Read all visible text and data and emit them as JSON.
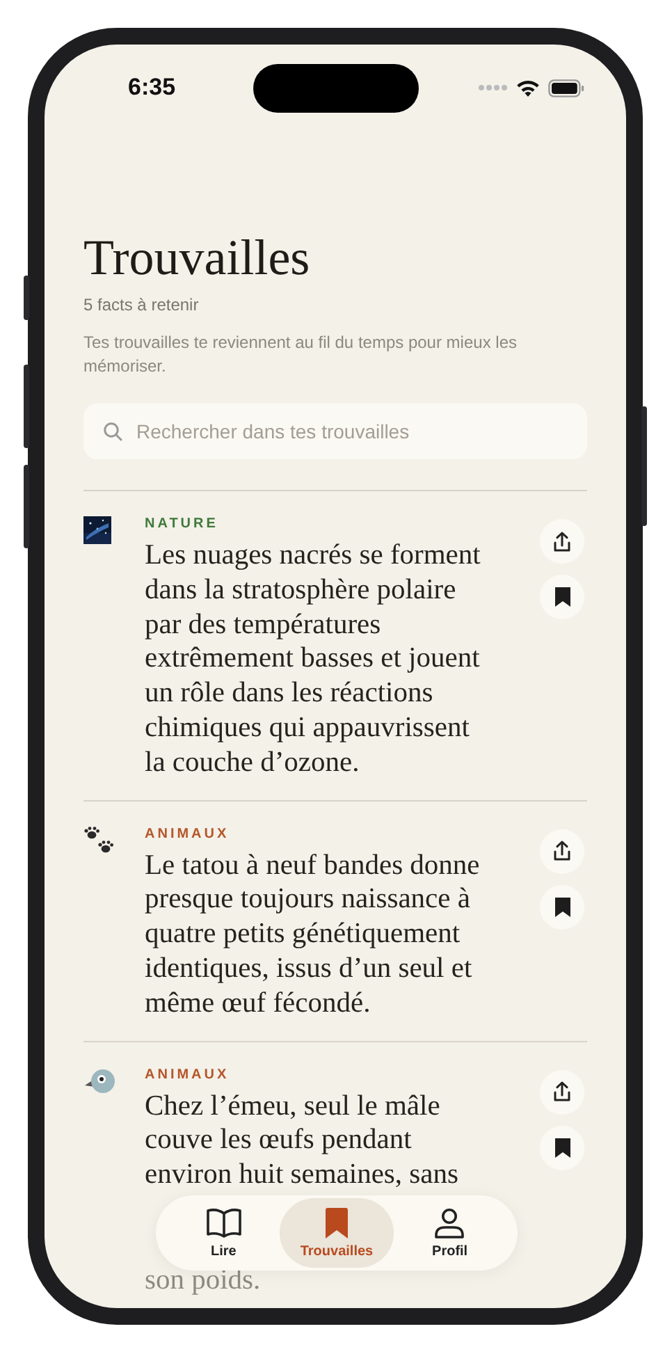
{
  "status_bar": {
    "time": "6:35"
  },
  "header": {
    "title": "Trouvailles",
    "count": "5 facts à retenir",
    "description": "Tes trouvailles te reviennent au fil du temps pour mieux les mémoriser."
  },
  "search": {
    "placeholder": "Rechercher dans tes trouvailles"
  },
  "facts": [
    {
      "kind": "picture",
      "category": "NATURE",
      "color": "#3f7a3a",
      "text": "Les nuages nacrés se forment dans la stratosphère polaire par des températures extrêmement basses et jouent un rôle dans les réactions chimiques qui appauvrissent la couche d’ozone."
    },
    {
      "kind": "paw",
      "category": "ANIMAUX",
      "color": "#b5562a",
      "text": "Le tatou à neuf bandes donne presque toujours naissance à quatre petits génétiquement identiques, issus d’un seul et même œuf fécondé."
    },
    {
      "kind": "bird",
      "category": "ANIMAUX",
      "color": "#b5562a",
      "text": "Chez l’émeu, seul le mâle couve les œufs pendant environ huit semaines, sans",
      "tail": "son poids."
    }
  ],
  "tab_bar": [
    {
      "kind": "book",
      "label": "Lire",
      "selected": false
    },
    {
      "kind": "bookmark",
      "label": "Trouvailles",
      "selected": true
    },
    {
      "kind": "person",
      "label": "Profil",
      "selected": false
    }
  ]
}
